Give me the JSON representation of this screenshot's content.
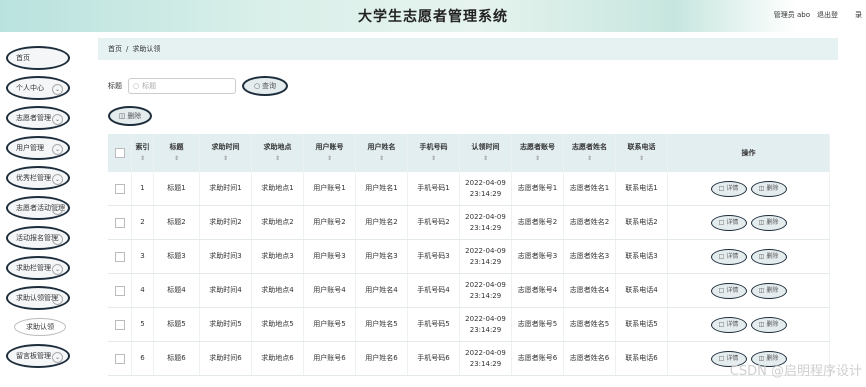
{
  "header": {
    "title": "大学生志愿者管理系统",
    "user": "管理员 abo",
    "logout": "退出登",
    "logout_tail": "录"
  },
  "sidebar": {
    "items": [
      {
        "label": "首页",
        "chevron": false
      },
      {
        "label": "个人中心",
        "chevron": true
      },
      {
        "label": "志愿者管理",
        "chevron": true
      },
      {
        "label": "用户管理",
        "chevron": true
      },
      {
        "label": "优秀栏管理",
        "chevron": true
      },
      {
        "label": "志愿者活动管理",
        "chevron": true
      },
      {
        "label": "活动报名管理",
        "chevron": true
      },
      {
        "label": "求助栏管理",
        "chevron": true
      },
      {
        "label": "求助认领管理",
        "chevron": true
      }
    ],
    "sub": "求助认领",
    "last": {
      "label": "留言板管理",
      "chevron": true
    }
  },
  "breadcrumb": {
    "home": "首页",
    "sep": "/",
    "current": "求助认领"
  },
  "search": {
    "label": "标题",
    "placeholder": "标题",
    "button": "查询"
  },
  "delete_label": "删除",
  "table": {
    "headers": [
      "索引",
      "标题",
      "求助时间",
      "求助地点",
      "用户账号",
      "用户姓名",
      "手机号码",
      "认领时间",
      "志愿者账号",
      "志愿者姓名",
      "联系电话",
      "操作"
    ],
    "detail_label": "详情",
    "delete_label": "删除",
    "rows": [
      {
        "idx": "1",
        "title": "标题1",
        "time": "求助时间1",
        "place": "求助地点1",
        "account": "用户账号1",
        "name": "用户姓名1",
        "phone": "手机号码1",
        "date": "2022-04-09",
        "clock": "23:14:29",
        "vacc": "志愿者账号1",
        "vname": "志愿者姓名1",
        "tel": "联系电话1"
      },
      {
        "idx": "2",
        "title": "标题2",
        "time": "求助时间2",
        "place": "求助地点2",
        "account": "用户账号2",
        "name": "用户姓名2",
        "phone": "手机号码2",
        "date": "2022-04-09",
        "clock": "23:14:29",
        "vacc": "志愿者账号2",
        "vname": "志愿者姓名2",
        "tel": "联系电话2"
      },
      {
        "idx": "3",
        "title": "标题3",
        "time": "求助时间3",
        "place": "求助地点3",
        "account": "用户账号3",
        "name": "用户姓名3",
        "phone": "手机号码3",
        "date": "2022-04-09",
        "clock": "23:14:29",
        "vacc": "志愿者账号3",
        "vname": "志愿者姓名3",
        "tel": "联系电话3"
      },
      {
        "idx": "4",
        "title": "标题4",
        "time": "求助时间4",
        "place": "求助地点4",
        "account": "用户账号4",
        "name": "用户姓名4",
        "phone": "手机号码4",
        "date": "2022-04-09",
        "clock": "23:14:29",
        "vacc": "志愿者账号4",
        "vname": "志愿者姓名4",
        "tel": "联系电话4"
      },
      {
        "idx": "5",
        "title": "标题5",
        "time": "求助时间5",
        "place": "求助地点5",
        "account": "用户账号5",
        "name": "用户姓名5",
        "phone": "手机号码5",
        "date": "2022-04-09",
        "clock": "23:14:29",
        "vacc": "志愿者账号5",
        "vname": "志愿者姓名5",
        "tel": "联系电话5"
      },
      {
        "idx": "6",
        "title": "标题6",
        "time": "求助时间6",
        "place": "求助地点6",
        "account": "用户账号6",
        "name": "用户姓名6",
        "phone": "手机号码6",
        "date": "2022-04-09",
        "clock": "23:14:29",
        "vacc": "志愿者账号6",
        "vname": "志愿者姓名6",
        "tel": "联系电话6"
      }
    ]
  },
  "watermark": "CSDN @启明程序设计",
  "icons": {
    "search": "search-icon",
    "delete": "trash-icon",
    "detail": "document-icon",
    "chevron": "chevron-down-icon"
  },
  "colors": {
    "topbar": "#b9e2de",
    "pill_border": "#1d2d3b",
    "table_header": "#e3eef1"
  }
}
